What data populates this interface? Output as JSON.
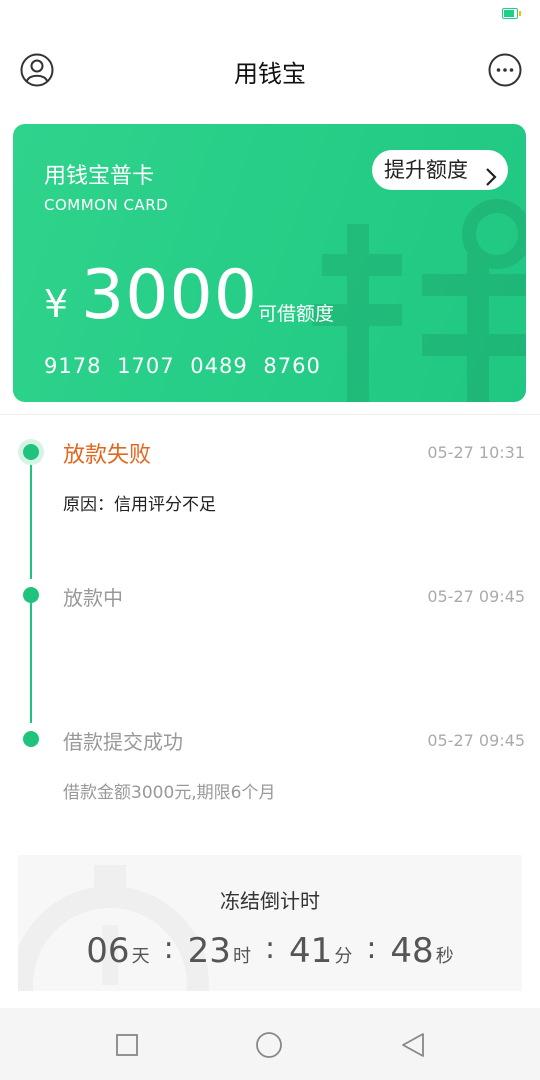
{
  "header": {
    "title": "用钱宝"
  },
  "card": {
    "name": "用钱宝普卡",
    "subtitle": "COMMON CARD",
    "raise_label": "提升额度",
    "currency": "¥",
    "amount": "3000",
    "amount_label": "可借额度",
    "card_number": "9178 1707 0489 8760"
  },
  "timeline": [
    {
      "title": "放款失败",
      "time": "05-27 10:31",
      "desc": "原因：信用评分不足"
    },
    {
      "title": "放款中",
      "time": "05-27 09:45"
    },
    {
      "title": "借款提交成功",
      "time": "05-27 09:45",
      "desc": "借款金额3000元,期限6个月"
    }
  ],
  "countdown": {
    "title": "冻结倒计时",
    "days": "06",
    "day_unit": "天",
    "hours": "23",
    "hour_unit": "时",
    "minutes": "41",
    "minute_unit": "分",
    "seconds": "48",
    "second_unit": "秒",
    "separator": ":"
  },
  "colors": {
    "brand_green": "#25cd86",
    "fail_orange": "#e2661d"
  },
  "icons": [
    "battery-icon",
    "user-icon",
    "more-icon",
    "chevron-right-icon",
    "stopwatch-icon",
    "square-icon",
    "circle-icon",
    "triangle-back-icon"
  ]
}
